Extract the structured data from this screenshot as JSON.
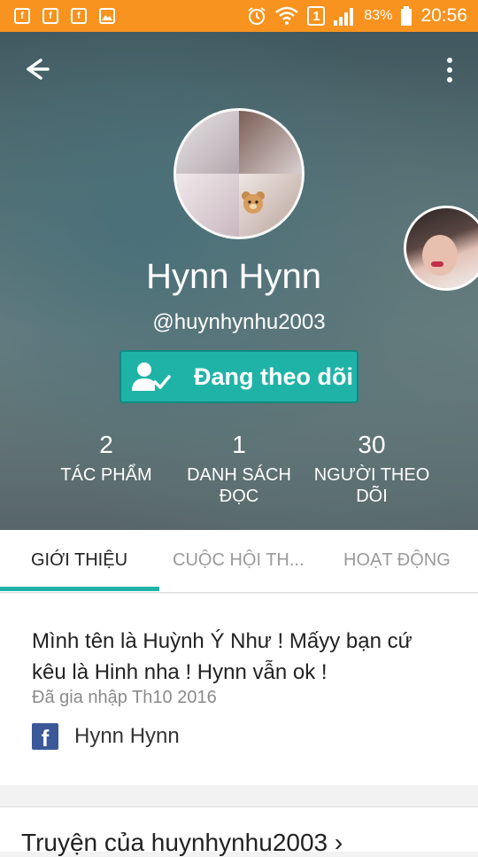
{
  "status_bar": {
    "left_icons": [
      "facebook-notification-icon",
      "facebook-notification-icon",
      "facebook-notification-icon",
      "image-notification-icon"
    ],
    "alarm_icon": "alarm-icon",
    "wifi_icon": "wifi-icon",
    "sim_label": "1",
    "signal_icon": "signal-icon",
    "battery_percent": "83%",
    "battery_icon": "battery-icon",
    "time": "20:56",
    "color": "#f7931e"
  },
  "header": {
    "back_icon": "back-arrow-icon",
    "more_icon": "more-vertical-icon",
    "display_name": "Hynn Hynn",
    "username": "@huynhynhu2003",
    "follow_button_label": "Đang theo dõi",
    "follow_icon": "user-check-icon",
    "stats": [
      {
        "value": "2",
        "label": "TÁC PHẨM"
      },
      {
        "value": "1",
        "label": "DANH SÁCH ĐỌC"
      },
      {
        "value": "30",
        "label": "NGƯỜI THEO DÕI"
      }
    ]
  },
  "tabs": {
    "items": [
      {
        "label": "GIỚI THIỆU",
        "active": true
      },
      {
        "label": "CUỘC HỘI TH...",
        "active": false
      },
      {
        "label": "HOẠT ĐỘNG",
        "active": false
      }
    ],
    "accent": "#1fb3a8"
  },
  "about": {
    "bio_line1": "Mình tên là Huỳnh Ý Như ! Mấyy bạn cứ",
    "bio_line2": "kêu là Hinh nha ! Hynn vẫn ok !",
    "joined": "Đã gia nhập Th10 2016",
    "facebook_name": "Hynn Hynn",
    "facebook_color": "#3b5998"
  },
  "stories": {
    "title": "Truyện của huynhynhu2003 ›"
  }
}
